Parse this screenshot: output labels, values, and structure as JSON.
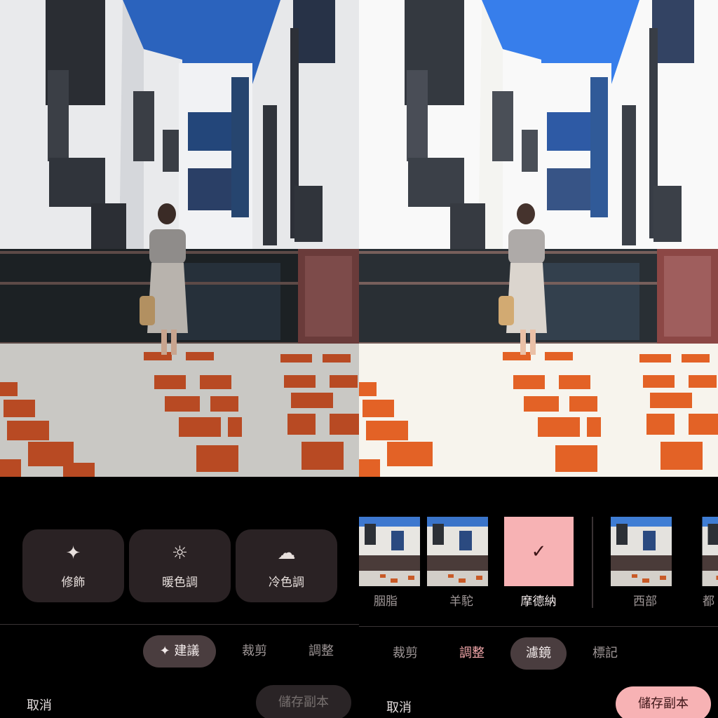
{
  "left": {
    "suggestions": [
      {
        "icon": "sparkle-icon",
        "label": "修飾"
      },
      {
        "icon": "sun-icon",
        "label": "暖色調"
      },
      {
        "icon": "cloud-icon",
        "label": "冷色調"
      }
    ],
    "tabs": {
      "suggest": "建議",
      "crop": "裁剪",
      "adjust": "調整"
    },
    "cancel": "取消",
    "save": "儲存副本"
  },
  "right": {
    "filters": [
      {
        "label": "胭脂"
      },
      {
        "label": "羊駝"
      },
      {
        "label": "摩德納",
        "selected": true
      },
      {
        "label": "西部"
      },
      {
        "label": "都"
      }
    ],
    "tabs": {
      "crop": "裁剪",
      "adjust": "調整",
      "filters": "濾鏡",
      "markup": "標記"
    },
    "cancel": "取消",
    "save": "儲存副本"
  },
  "colors": {
    "accent": "#f7b2b4",
    "card": "#2a2224",
    "pill": "#4a3d3f",
    "background": "#000000"
  }
}
